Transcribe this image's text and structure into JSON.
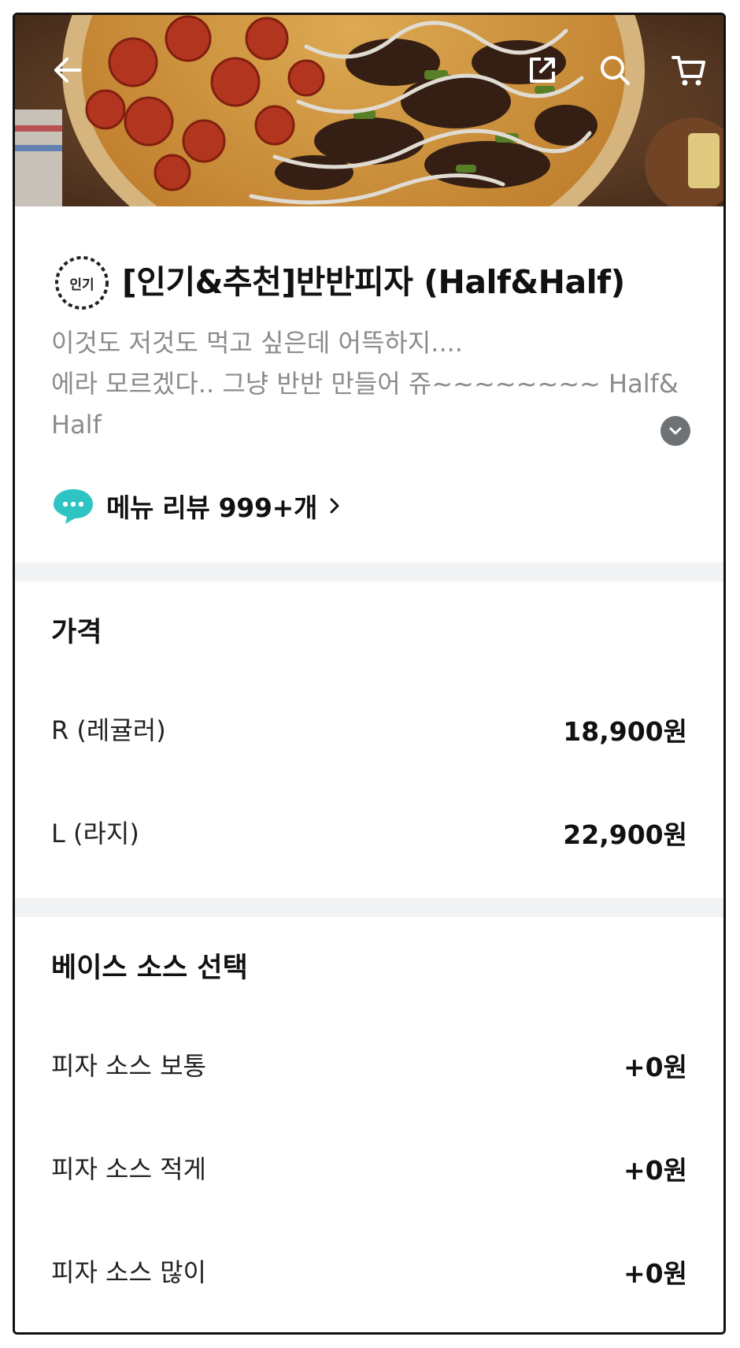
{
  "hero": {
    "back_icon": "arrow-left-icon",
    "share_icon": "share-icon",
    "search_icon": "search-icon",
    "cart_icon": "cart-icon"
  },
  "menu": {
    "badge_text": "인기",
    "title": "[인기&추천]반반피자 (Half&Half)",
    "description_lines": [
      "이것도 저것도 먹고 싶은데 어뜩하지....",
      "에라 모르겠다.. 그냥 반반 만들어 쥬~~~~~~~~ Half&",
      "Half"
    ],
    "review_label": "메뉴 리뷰 999+개"
  },
  "price": {
    "title": "가격",
    "options": [
      {
        "label": "R (레귤러)",
        "value": "18,900원"
      },
      {
        "label": "L (라지)",
        "value": "22,900원"
      }
    ]
  },
  "sauce": {
    "title": "베이스 소스 선택",
    "options": [
      {
        "label": "피자 소스 보통",
        "value": "+0원"
      },
      {
        "label": "피자 소스 적게",
        "value": "+0원"
      },
      {
        "label": "피자 소스 많이",
        "value": "+0원"
      }
    ]
  },
  "colors": {
    "accent_review": "#2ec4c4",
    "divider": "#f2f3f5",
    "description": "#8b8b8b"
  }
}
